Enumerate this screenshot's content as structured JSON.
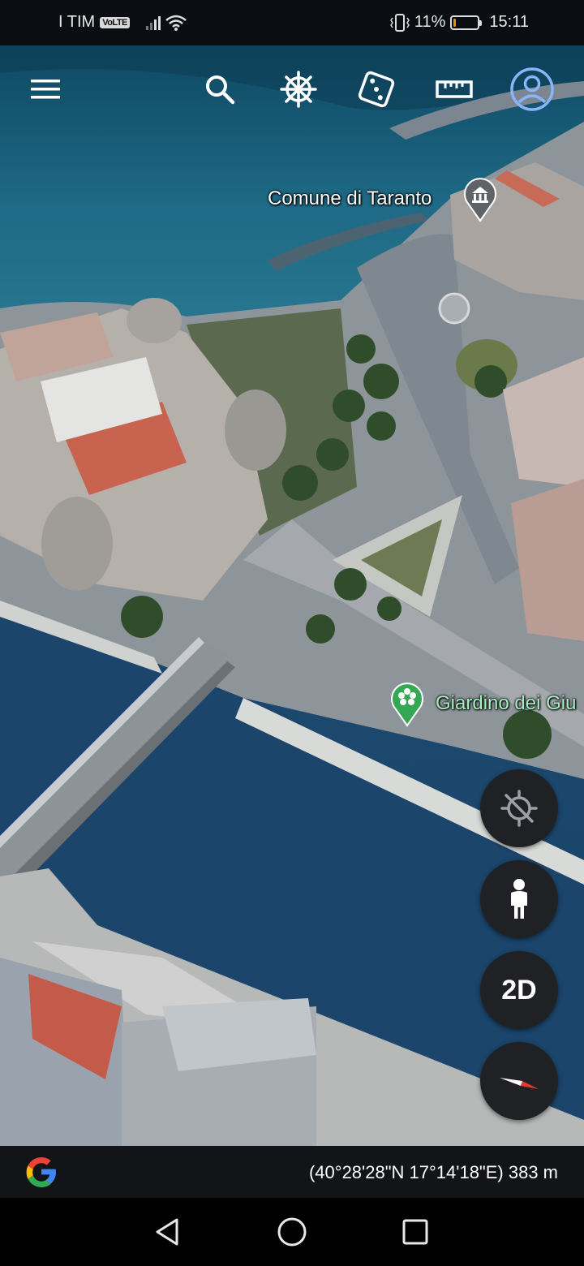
{
  "status_bar": {
    "carrier": "I TIM",
    "volte_badge": "VoLTE",
    "battery_text": "11%",
    "battery_level": 0.11,
    "battery_color": "#f08a00",
    "time": "15:11",
    "icons": [
      "signal-icon",
      "wifi-icon",
      "vibrate-icon",
      "battery-icon"
    ]
  },
  "toolbar": {
    "icons": [
      "menu-icon",
      "search-icon",
      "voyager-wheel-icon",
      "random-dice-icon",
      "measure-ruler-icon",
      "account-icon"
    ],
    "accent_color": "#8ab4f8"
  },
  "map": {
    "places": [
      {
        "name": "Comune di Taranto",
        "icon": "town-hall-icon"
      },
      {
        "name": "Giardino dei Giu",
        "icon": "park-icon",
        "color": "#a7f0c4"
      }
    ],
    "water_color": "#164565"
  },
  "controls": {
    "view_mode_label": "2D",
    "icons": [
      "location-off-icon",
      "street-view-pegman-icon",
      "compass-icon"
    ]
  },
  "footer": {
    "logo": "google-g-logo",
    "coordinates": "(40°28'28\"N 17°14'18\"E) 383 m"
  },
  "nav_bar": {
    "icons": [
      "back-icon",
      "home-icon",
      "recents-icon"
    ]
  }
}
